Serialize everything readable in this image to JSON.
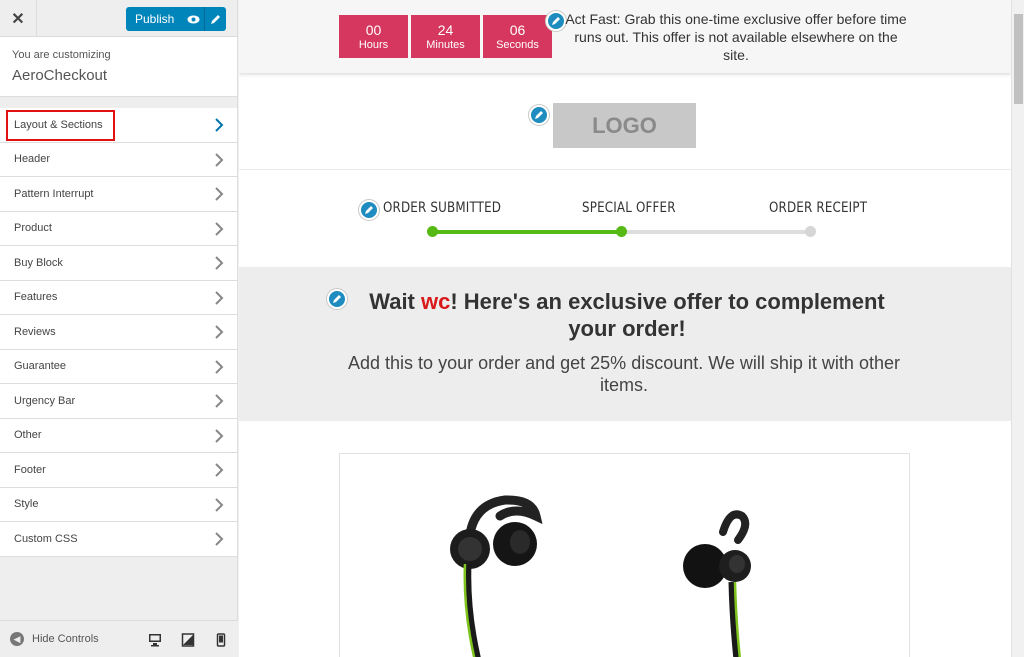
{
  "sidebar": {
    "close_icon": "close-icon",
    "publish_label": "Publish",
    "customizing_label": "You are customizing",
    "site_name": "AeroCheckout",
    "items": [
      {
        "label": "Layout & Sections"
      },
      {
        "label": "Header"
      },
      {
        "label": "Pattern Interrupt"
      },
      {
        "label": "Product"
      },
      {
        "label": "Buy Block"
      },
      {
        "label": "Features"
      },
      {
        "label": "Reviews"
      },
      {
        "label": "Guarantee"
      },
      {
        "label": "Urgency Bar"
      },
      {
        "label": "Other"
      },
      {
        "label": "Footer"
      },
      {
        "label": "Style"
      },
      {
        "label": "Custom CSS"
      }
    ],
    "hide_controls_label": "Hide Controls",
    "accent_color": "#0085ba",
    "highlight_color": "#e11111"
  },
  "preview": {
    "countdown": [
      {
        "value": "00",
        "unit": "Hours"
      },
      {
        "value": "24",
        "unit": "Minutes"
      },
      {
        "value": "06",
        "unit": "Seconds"
      }
    ],
    "countdown_color": "#d5375e",
    "urgency_text": "Act Fast: Grab this one-time exclusive offer before time runs out. This offer is not available elsewhere on the site.",
    "logo_text": "LOGO",
    "steps": [
      {
        "label": "ORDER SUBMITTED"
      },
      {
        "label": "SPECIAL OFFER"
      },
      {
        "label": "ORDER RECEIPT"
      }
    ],
    "progress_color": "#56b914",
    "hero": {
      "title_pre": "Wait ",
      "title_name": "wc",
      "title_post": "! Here's an exclusive offer to complement your order!",
      "subtitle": "Add this to your order and get 25% discount. We will ship it with other items."
    }
  }
}
